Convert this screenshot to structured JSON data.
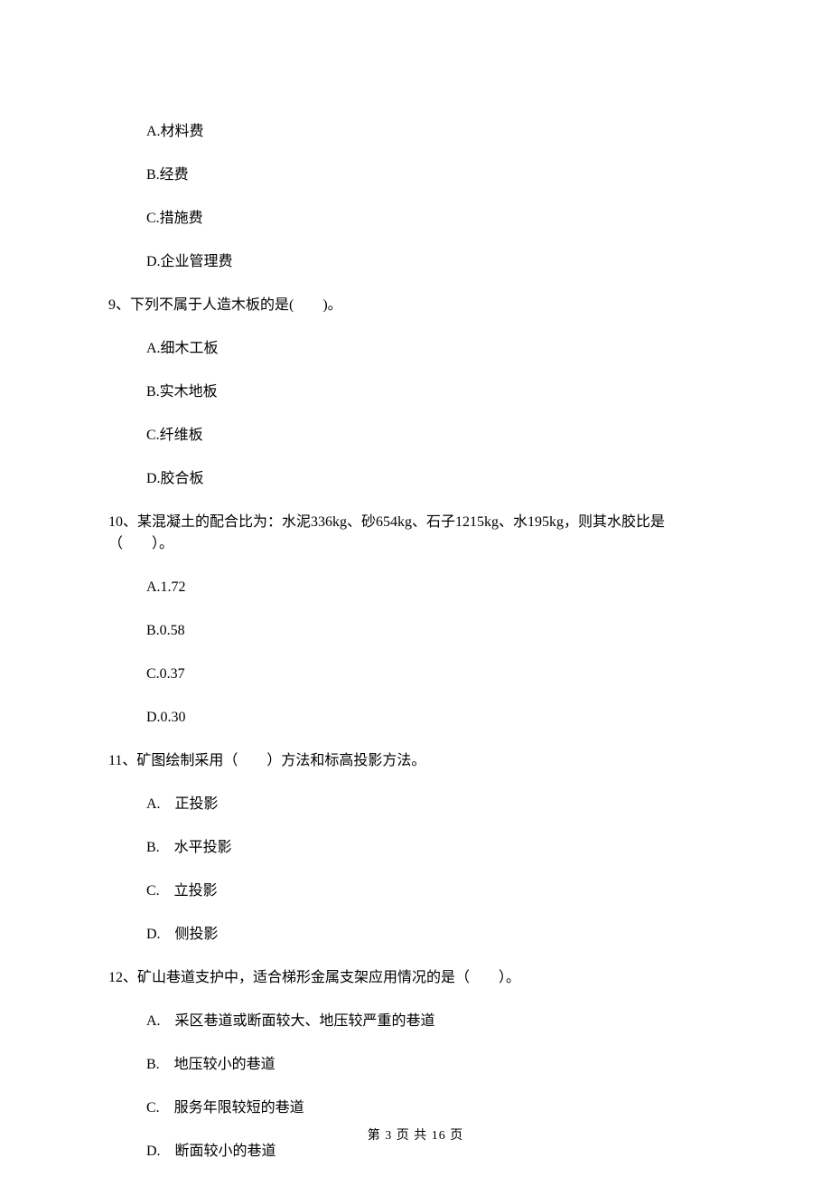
{
  "q8": {
    "options": {
      "A": "A.材料费",
      "B": "B.经费",
      "C": "C.措施费",
      "D": "D.企业管理费"
    }
  },
  "q9": {
    "stem": "9、下列不属于人造木板的是(　　)。",
    "options": {
      "A": "A.细木工板",
      "B": "B.实木地板",
      "C": "C.纤维板",
      "D": "D.胶合板"
    }
  },
  "q10": {
    "stem": "10、某混凝土的配合比为：水泥336kg、砂654kg、石子1215kg、水195kg，则其水胶比是（　　）。",
    "options": {
      "A": "A.1.72",
      "B": "B.0.58",
      "C": "C.0.37",
      "D": "D.0.30"
    }
  },
  "q11": {
    "stem": "11、矿图绘制采用（　　）方法和标高投影方法。",
    "options": {
      "A": "A.　正投影",
      "B": "B.　水平投影",
      "C": "C.　立投影",
      "D": "D.　侧投影"
    }
  },
  "q12": {
    "stem": "12、矿山巷道支护中，适合梯形金属支架应用情况的是（　　）。",
    "options": {
      "A": "A.　采区巷道或断面较大、地压较严重的巷道",
      "B": "B.　地压较小的巷道",
      "C": "C.　服务年限较短的巷道",
      "D": "D.　断面较小的巷道"
    }
  },
  "footer": "第 3 页 共 16 页"
}
